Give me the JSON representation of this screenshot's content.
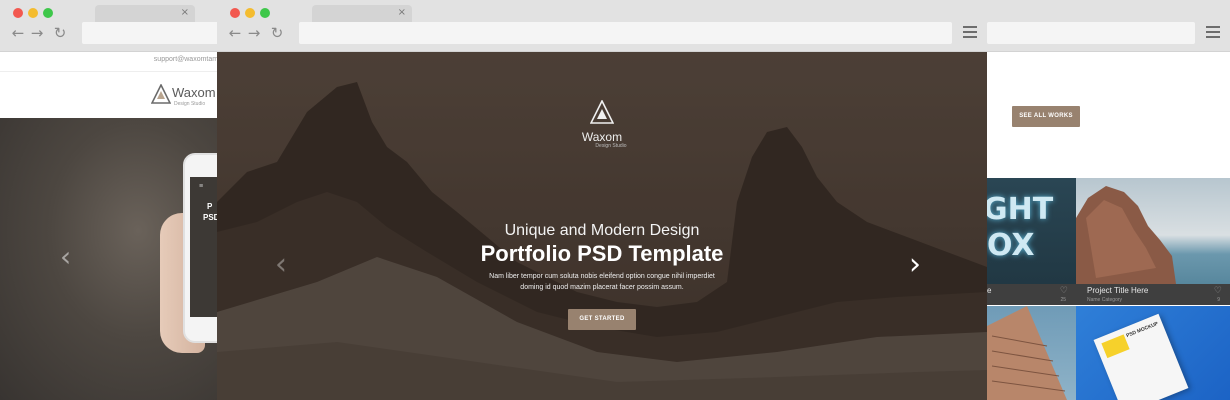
{
  "left_window": {
    "email": "support@waxomtamp",
    "logo_text": "Waxom",
    "logo_sub": "Design Studio",
    "phone_text_1": "P",
    "phone_text_2": "PSD"
  },
  "center_window": {
    "logo_text": "Waxom",
    "logo_sub": "Design Studio",
    "hero_subtitle": "Unique and Modern Design",
    "hero_title": "Portfolio PSD Template",
    "hero_desc_line1": "Nam liber tempor cum soluta nobis eleifend option congue nihil imperdiet",
    "hero_desc_line2": "doming id quod mazim placerat facer possim assum.",
    "cta_label": "GET STARTED"
  },
  "right_window": {
    "see_all_label": "SEE ALL WORKS",
    "tile1": {
      "letters_top": "GHT",
      "letters_bottom": "OX",
      "title_fragment": "e",
      "count": "25"
    },
    "tile2": {
      "title": "Project Title Here",
      "category": "Name Category",
      "count": "9"
    },
    "tile4": {
      "mockup_label": "PSD MOCKUP"
    }
  },
  "icons": {
    "tab_close": "×",
    "back": "←",
    "forward": "→",
    "reload": "↻",
    "arrow_left": "‹",
    "arrow_right": "›",
    "heart": "♡"
  },
  "colors": {
    "accent_button": "#98826f",
    "chrome": "#e2e2e2",
    "tile_footer": "#3f3f3f"
  }
}
